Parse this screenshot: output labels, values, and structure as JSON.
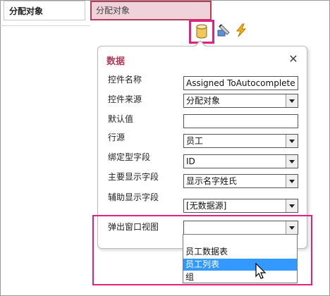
{
  "form": {
    "field_label": "分配对象",
    "field_control": "分配对象"
  },
  "toolbar": {
    "icons": [
      "data-icon",
      "format-icon",
      "action-icon"
    ]
  },
  "panel": {
    "title": "数据",
    "close_glyph": "✕",
    "rows": [
      {
        "label": "控件名称",
        "value": "Assigned ToAutocomplete",
        "kind": "input"
      },
      {
        "label": "控件来源",
        "value": "分配对象",
        "kind": "select"
      },
      {
        "label": "默认值",
        "value": "",
        "kind": "input"
      },
      {
        "label": "行源",
        "value": "员工",
        "kind": "select"
      },
      {
        "label": "绑定型字段",
        "value": "ID",
        "kind": "select"
      },
      {
        "label": "主要显示字段",
        "value": "显示名字姓氏",
        "kind": "select"
      },
      {
        "label": "辅助显示字段",
        "value": "[无数据源]",
        "kind": "select"
      },
      {
        "label": "弹出窗口视图",
        "value": "",
        "kind": "select"
      }
    ],
    "dropdown_options": [
      "员工数据表",
      "员工列表",
      "组"
    ],
    "dropdown_selected_index": 1
  },
  "colors": {
    "highlight": "#e0227e",
    "title": "#b03a5b",
    "selected": "#3399ff"
  }
}
